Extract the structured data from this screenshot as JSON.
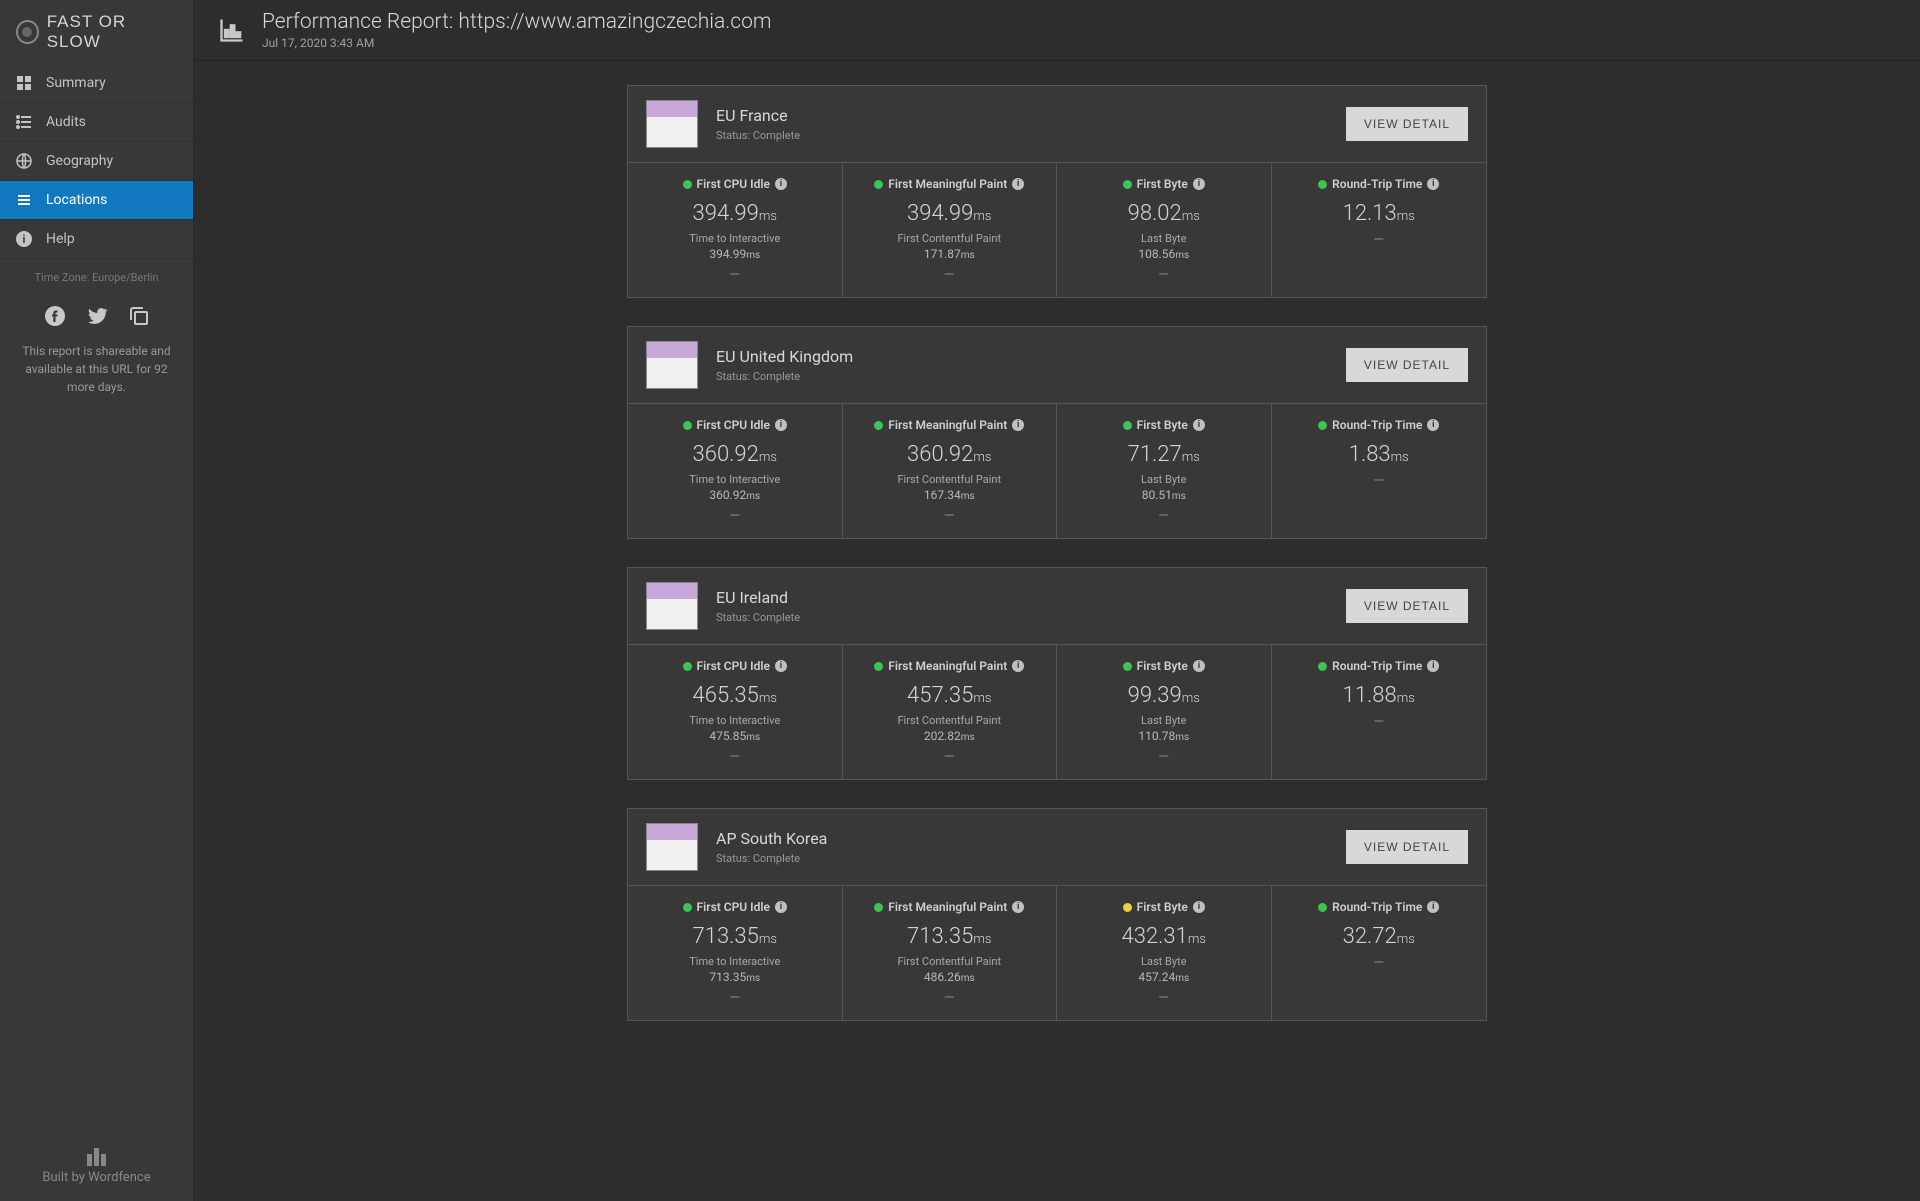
{
  "brand": "FAST OR SLOW",
  "nav": [
    {
      "icon": "grid",
      "label": "Summary"
    },
    {
      "icon": "list",
      "label": "Audits"
    },
    {
      "icon": "globe",
      "label": "Geography"
    },
    {
      "icon": "lines",
      "label": "Locations"
    },
    {
      "icon": "info",
      "label": "Help"
    }
  ],
  "timezone": "Time Zone: Europe/Berlin",
  "share_text": "This report is shareable and available at this URL for 92 more days.",
  "built_by": "Built by Wordfence",
  "header": {
    "title": "Performance Report: https://www.amazingczechia.com",
    "date": "Jul 17, 2020 3:43 AM"
  },
  "status_prefix": "Status: ",
  "view_detail": "VIEW DETAIL",
  "metric_labels": {
    "cpu": "First CPU Idle",
    "fmp": "First Meaningful Paint",
    "fb": "First Byte",
    "rtt": "Round-Trip Time",
    "tti": "Time to Interactive",
    "fcp": "First Contentful Paint",
    "lb": "Last Byte"
  },
  "locations": [
    {
      "name": "EU France",
      "status": "Complete",
      "cpu": {
        "dot": "g",
        "v": "394.99",
        "u": "ms",
        "sub": "394.99",
        "su": "ms"
      },
      "fmp": {
        "dot": "g",
        "v": "394.99",
        "u": "ms",
        "sub": "171.87",
        "su": "ms"
      },
      "fb": {
        "dot": "g",
        "v": "98.02",
        "u": "ms",
        "sub": "108.56",
        "su": "ms"
      },
      "rtt": {
        "dot": "g",
        "v": "12.13",
        "u": "ms"
      }
    },
    {
      "name": "EU United Kingdom",
      "status": "Complete",
      "cpu": {
        "dot": "g",
        "v": "360.92",
        "u": "ms",
        "sub": "360.92",
        "su": "ms"
      },
      "fmp": {
        "dot": "g",
        "v": "360.92",
        "u": "ms",
        "sub": "167.34",
        "su": "ms"
      },
      "fb": {
        "dot": "g",
        "v": "71.27",
        "u": "ms",
        "sub": "80.51",
        "su": "ms"
      },
      "rtt": {
        "dot": "g",
        "v": "1.83",
        "u": "ms"
      }
    },
    {
      "name": "EU Ireland",
      "status": "Complete",
      "cpu": {
        "dot": "g",
        "v": "465.35",
        "u": "ms",
        "sub": "475.85",
        "su": "ms"
      },
      "fmp": {
        "dot": "g",
        "v": "457.35",
        "u": "ms",
        "sub": "202.82",
        "su": "ms"
      },
      "fb": {
        "dot": "g",
        "v": "99.39",
        "u": "ms",
        "sub": "110.78",
        "su": "ms"
      },
      "rtt": {
        "dot": "g",
        "v": "11.88",
        "u": "ms"
      }
    },
    {
      "name": "AP South Korea",
      "status": "Complete",
      "cpu": {
        "dot": "g",
        "v": "713.35",
        "u": "ms",
        "sub": "713.35",
        "su": "ms"
      },
      "fmp": {
        "dot": "g",
        "v": "713.35",
        "u": "ms",
        "sub": "486.26",
        "su": "ms"
      },
      "fb": {
        "dot": "y",
        "v": "432.31",
        "u": "ms",
        "sub": "457.24",
        "su": "ms"
      },
      "rtt": {
        "dot": "g",
        "v": "32.72",
        "u": "ms"
      }
    }
  ]
}
